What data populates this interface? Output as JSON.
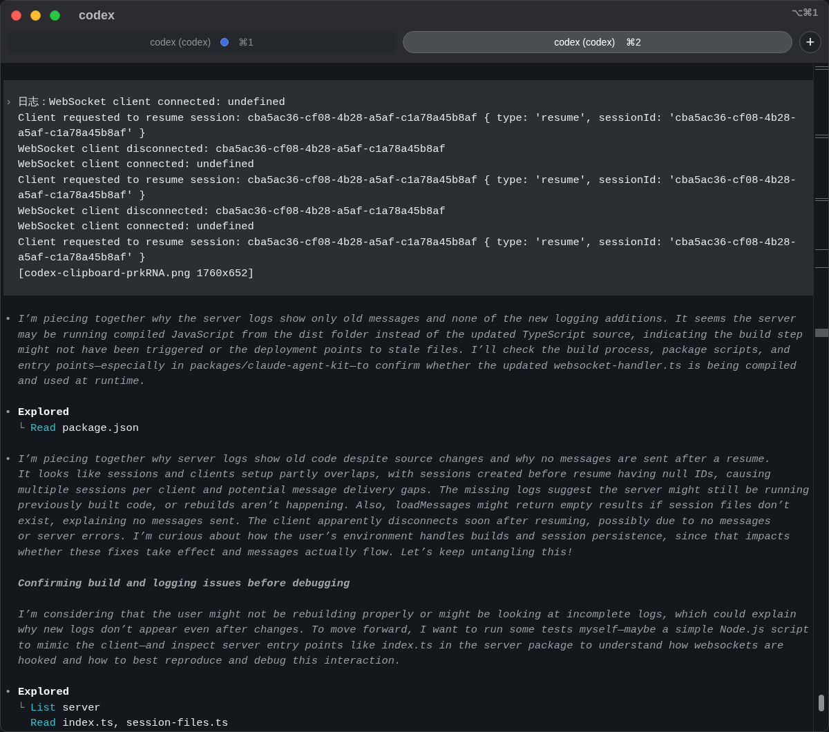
{
  "window": {
    "title": "codex",
    "shortcut": "⌥⌘1"
  },
  "tabs": [
    {
      "label": "codex (codex)",
      "shortcut": "⌘1",
      "selected": false,
      "activity_dot": true
    },
    {
      "label": "codex (codex)",
      "shortcut": "⌘2",
      "selected": true,
      "activity_dot": false
    }
  ],
  "new_tab_button": "+",
  "blocks": [
    {
      "kind": "input",
      "prompt": "›",
      "lines": [
        "日志：WebSocket client connected: undefined",
        "Client requested to resume session: cba5ac36-cf08-4b28-a5af-c1a78a45b8af { type: 'resume', sessionId: 'cba5ac36-cf08-4b28-",
        "a5af-c1a78a45b8af' }",
        "WebSocket client disconnected: cba5ac36-cf08-4b28-a5af-c1a78a45b8af",
        "WebSocket client connected: undefined",
        "Client requested to resume session: cba5ac36-cf08-4b28-a5af-c1a78a45b8af { type: 'resume', sessionId: 'cba5ac36-cf08-4b28-",
        "a5af-c1a78a45b8af' }",
        "WebSocket client disconnected: cba5ac36-cf08-4b28-a5af-c1a78a45b8af",
        "WebSocket client connected: undefined",
        "Client requested to resume session: cba5ac36-cf08-4b28-a5af-c1a78a45b8af { type: 'resume', sessionId: 'cba5ac36-cf08-4b28-",
        "a5af-c1a78a45b8af' }",
        "[codex-clipboard-prkRNA.png 1760x652]"
      ]
    },
    {
      "kind": "reasoning",
      "bullet": "•",
      "paragraphs": [
        {
          "kind": "text",
          "lines": [
            "I’m piecing together why the server logs show only old messages and none of the new logging additions. It seems the server",
            "may be running compiled JavaScript from the dist folder instead of the updated TypeScript source, indicating the build step",
            "might not have been triggered or the deployment points to stale files. I’ll check the build process, package scripts, and",
            "entry points—especially in packages/claude-agent-kit—to confirm whether the updated websocket-handler.ts is being compiled",
            "and used at runtime."
          ]
        }
      ]
    },
    {
      "kind": "explored",
      "bullet": "•",
      "title": "Explored",
      "items": [
        {
          "prefix": "└",
          "verb": "Read",
          "target": "package.json"
        }
      ]
    },
    {
      "kind": "reasoning",
      "bullet": "•",
      "paragraphs": [
        {
          "kind": "text",
          "lines": [
            "I’m piecing together why server logs show old code despite source changes and why no messages are sent after a resume.",
            "It looks like sessions and clients setup partly overlaps, with sessions created before resume having null IDs, causing",
            "multiple sessions per client and potential message delivery gaps. The missing logs suggest the server might still be running",
            "previously built code, or rebuilds aren’t happening. Also, loadMessages might return empty results if session files don’t",
            "exist, explaining no messages sent. The client apparently disconnects soon after resuming, possibly due to no messages",
            "or server errors. I’m curious about how the user’s environment handles builds and session persistence, since that impacts",
            "whether these fixes take effect and messages actually flow. Let’s keep untangling this!"
          ]
        },
        {
          "kind": "heading",
          "text": "Confirming build and logging issues before debugging"
        },
        {
          "kind": "text",
          "lines": [
            "I’m considering that the user might not be rebuilding properly or might be looking at incomplete logs, which could explain",
            "why new logs don’t appear even after changes. To move forward, I want to run some tests myself—maybe a simple Node.js script",
            "to mimic the client—and inspect server entry points like index.ts in the server package to understand how websockets are",
            "hooked and how to best reproduce and debug this interaction."
          ]
        }
      ]
    },
    {
      "kind": "explored",
      "bullet": "•",
      "title": "Explored",
      "items": [
        {
          "prefix": "└",
          "verb": "List",
          "target": "server"
        },
        {
          "verb": "Read",
          "target": "index.ts, session-files.ts"
        }
      ]
    }
  ]
}
